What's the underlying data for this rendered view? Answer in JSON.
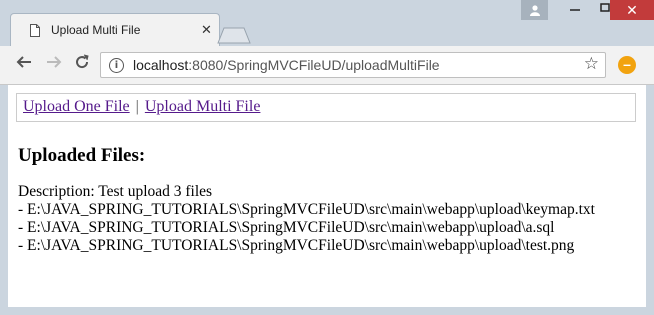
{
  "browser": {
    "tab_title": "Upload Multi File",
    "url_host": "localhost",
    "url_rest": ":8080/SpringMVCFileUD/uploadMultiFile"
  },
  "page": {
    "nav_links": [
      "Upload One File",
      "Upload Multi File"
    ],
    "separator": "|",
    "heading": "Uploaded Files:",
    "lines": [
      "Description: Test upload 3 files",
      "- E:\\JAVA_SPRING_TUTORIALS\\SpringMVCFileUD\\src\\main\\webapp\\upload\\keymap.txt",
      "- E:\\JAVA_SPRING_TUTORIALS\\SpringMVCFileUD\\src\\main\\webapp\\upload\\a.sql",
      "- E:\\JAVA_SPRING_TUTORIALS\\SpringMVCFileUD\\src\\main\\webapp\\upload\\test.png"
    ]
  },
  "colors": {
    "link": "#551a8b",
    "close_button": "#c23b3b",
    "extension": "#f2a30f"
  },
  "icons": [
    "page-icon",
    "close-icon",
    "back-icon",
    "forward-icon",
    "reload-icon",
    "info-icon",
    "star-icon",
    "extension-icon",
    "user-icon",
    "minimize-icon",
    "maximize-icon",
    "window-close-icon"
  ]
}
